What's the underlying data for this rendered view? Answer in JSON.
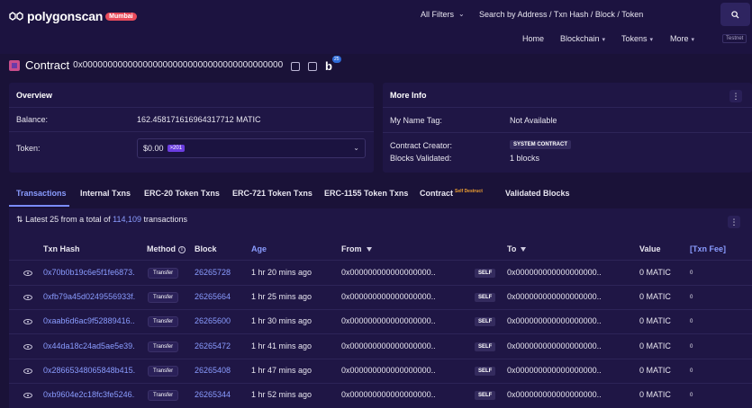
{
  "header": {
    "logo_text": "polygonscan",
    "network_badge": "Mumbai",
    "filter_label": "All Filters",
    "search_placeholder": "Search by Address / Txn Hash / Block / Token",
    "nav": [
      {
        "label": "Home",
        "has_chevron": false
      },
      {
        "label": "Blockchain",
        "has_chevron": true
      },
      {
        "label": "Tokens",
        "has_chevron": true
      },
      {
        "label": "More",
        "has_chevron": true
      }
    ],
    "testnet_label": "Testnet"
  },
  "contract": {
    "label": "Contract",
    "address": "0x0000000000000000000000000000000000000000",
    "badge_letter": "b",
    "badge_count": "25"
  },
  "overview": {
    "title": "Overview",
    "balance_label": "Balance:",
    "balance_value": "162.4581716169643177​12 MATIC",
    "token_label": "Token:",
    "token_value": "$0.00",
    "token_count": ">201"
  },
  "more_info": {
    "title": "More Info",
    "name_tag_label": "My Name Tag:",
    "name_tag_value": "Not Available",
    "creator_label": "Contract Creator:",
    "creator_value": "SYSTEM CONTRACT",
    "blocks_label": "Blocks Validated:",
    "blocks_value": "1 blocks"
  },
  "tabs": [
    {
      "label": "Transactions",
      "active": true
    },
    {
      "label": "Internal Txns",
      "active": false
    },
    {
      "label": "ERC-20 Token Txns",
      "active": false
    },
    {
      "label": "ERC-721 Token Txns",
      "active": false
    },
    {
      "label": "ERC-1155 Token Txns",
      "active": false
    },
    {
      "label": "Contract",
      "active": false,
      "sup": "Self Destruct"
    },
    {
      "label": "Validated Blocks",
      "active": false
    }
  ],
  "summary": {
    "prefix": "Latest 25 from a total of",
    "count": "114,109",
    "suffix": "transactions"
  },
  "table": {
    "headers": {
      "hash": "Txn Hash",
      "method": "Method",
      "block": "Block",
      "age": "Age",
      "from": "From",
      "to": "To",
      "value": "Value",
      "fee": "[Txn Fee]"
    },
    "rows": [
      {
        "hash": "0x70b0b19c6e5f1fe6873...",
        "method": "Transfer",
        "block": "26265728",
        "age": "1 hr 20 mins ago",
        "from": "0x000000000000000000...",
        "badge": "SELF",
        "to": "0x000000000000000000...",
        "value": "0 MATIC",
        "fee": "0"
      },
      {
        "hash": "0xfb79a45d0249556933f...",
        "method": "Transfer",
        "block": "26265664",
        "age": "1 hr 25 mins ago",
        "from": "0x000000000000000000...",
        "badge": "SELF",
        "to": "0x000000000000000000...",
        "value": "0 MATIC",
        "fee": "0"
      },
      {
        "hash": "0xaab6d6ac9f52889416...",
        "method": "Transfer",
        "block": "26265600",
        "age": "1 hr 30 mins ago",
        "from": "0x000000000000000000...",
        "badge": "SELF",
        "to": "0x000000000000000000...",
        "value": "0 MATIC",
        "fee": "0"
      },
      {
        "hash": "0x44da18c24ad5ae5e39...",
        "method": "Transfer",
        "block": "26265472",
        "age": "1 hr 41 mins ago",
        "from": "0x000000000000000000...",
        "badge": "SELF",
        "to": "0x000000000000000000...",
        "value": "0 MATIC",
        "fee": "0"
      },
      {
        "hash": "0x28665348065848b415...",
        "method": "Transfer",
        "block": "26265408",
        "age": "1 hr 47 mins ago",
        "from": "0x000000000000000000...",
        "badge": "SELF",
        "to": "0x000000000000000000...",
        "value": "0 MATIC",
        "fee": "0"
      },
      {
        "hash": "0xb9604e2c18fc3fe5246...",
        "method": "Transfer",
        "block": "26265344",
        "age": "1 hr 52 mins ago",
        "from": "0x000000000000000000...",
        "badge": "SELF",
        "to": "0x000000000000000000...",
        "value": "0 MATIC",
        "fee": "0"
      }
    ]
  }
}
